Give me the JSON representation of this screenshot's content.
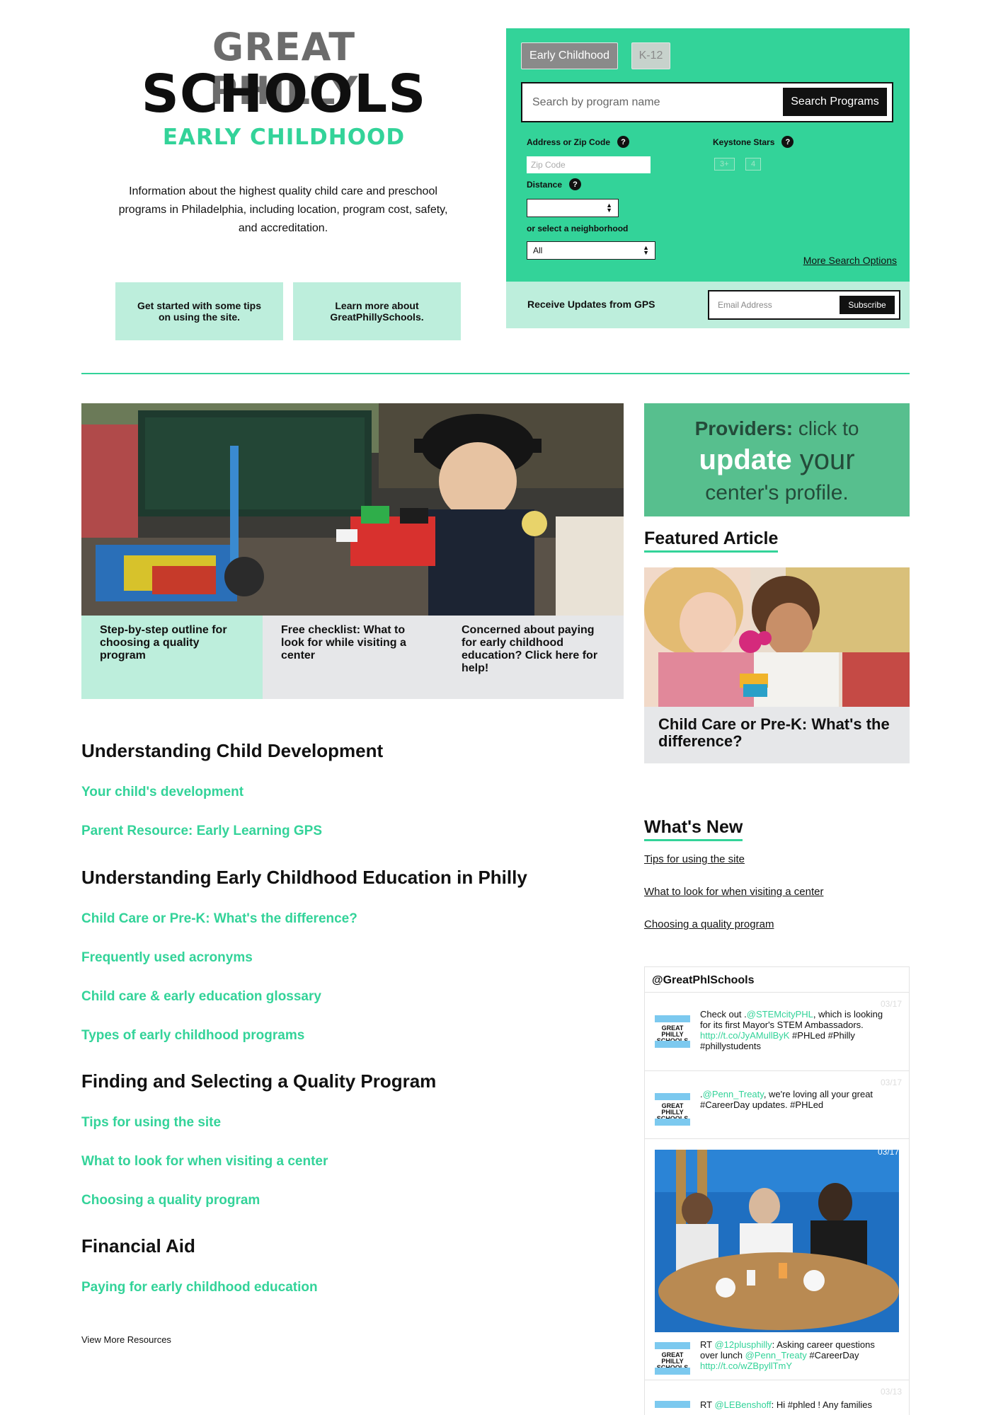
{
  "logo": {
    "line1": "GREAT PHILLY",
    "line2": "SCHOOLS",
    "line3": "EARLY CHILDHOOD"
  },
  "intro": "Information about the highest quality child care and preschool programs in Philadelphia, including location, program cost, safety, and accreditation.",
  "tips": [
    "Get started with some tips on using the site.",
    "Learn more about GreatPhillySchools."
  ],
  "search": {
    "tabs": [
      "Early Childhood",
      "K-12"
    ],
    "placeholder": "Search by program name",
    "button": "Search Programs",
    "address_label": "Address or Zip Code",
    "zip_placeholder": "Zip Code",
    "distance_label": "Distance",
    "distance_value": "",
    "neighborhood_label": "or select a neighborhood",
    "neighborhood_value": "All",
    "stars_label": "Keystone Stars",
    "stars_options": [
      "3+",
      "4"
    ],
    "help": "?",
    "more_options": "More Search Options"
  },
  "updates": {
    "label": "Receive Updates from GPS",
    "email_placeholder": "Email Address",
    "button": "Subscribe"
  },
  "hero_cards": [
    "Step-by-step outline for choosing a quality program",
    "Free checklist: What to look for while visiting a center",
    "Concerned about paying for early childhood education? Click here for help!"
  ],
  "resources": [
    {
      "heading": "Understanding Child Development",
      "links": [
        "Your child's development",
        "Parent Resource: Early Learning GPS"
      ]
    },
    {
      "heading": "Understanding Early Childhood Education in Philly",
      "links": [
        "Child Care or Pre-K: What's the difference?",
        "Frequently used acronyms",
        "Child care & early education glossary",
        "Types of early childhood programs"
      ]
    },
    {
      "heading": "Finding and Selecting a Quality Program",
      "links": [
        "Tips for using the site",
        "What to look for when visiting a center",
        "Choosing a quality program"
      ]
    },
    {
      "heading": "Financial Aid",
      "links": [
        "Paying for early childhood education"
      ]
    }
  ],
  "view_more": "View More Resources",
  "providers": {
    "bold": "Providers:",
    "l1_rest": " click to",
    "l2_bold": "update",
    "l2_rest": " your",
    "l3": "center's profile."
  },
  "featured": {
    "heading": "Featured Article",
    "caption": "Child Care or Pre-K: What's the difference?"
  },
  "whats_new": {
    "heading": "What's New",
    "links": [
      "Tips for using the site",
      "What to look for when visiting a center",
      "Choosing a quality program"
    ]
  },
  "twitter": {
    "handle": "@GreatPhlSchools",
    "avatar_text": "GREAT PHILLY SCHOOLS",
    "tweets": [
      {
        "date": "03/17",
        "pre": "Check out .",
        "mention": "@STEMcityPHL",
        "mid": ", which is looking for its first Mayor's STEM Ambassadors. ",
        "link": "http://t.co/JyAMullByK",
        "post": " #PHLed #Philly #phillystudents"
      },
      {
        "date": "03/17",
        "pre": ".",
        "mention": "@Penn_Treaty",
        "mid": ", we're loving all your great #CareerDay updates. #PHLed",
        "link": "",
        "post": ""
      },
      {
        "date": "03/17",
        "pre": "RT ",
        "mention": "@12plusphilly",
        "mid": ": Asking career questions over lunch ",
        "mention2": "@Penn_Treaty",
        "mid2": " #CareerDay ",
        "link": "http://t.co/wZBpyllTmY",
        "post": ""
      },
      {
        "date": "03/13",
        "pre": "RT ",
        "mention": "@LEBenshoff",
        "mid": ": Hi #phled ! Any families",
        "link": "",
        "post": ""
      }
    ]
  },
  "colors": {
    "accent": "#33d399",
    "mint": "#bdeedc",
    "grey": "#e6e7e9",
    "providers": "#57bf8e"
  }
}
